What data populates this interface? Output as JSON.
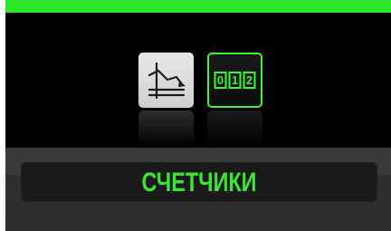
{
  "screen": {
    "accent_color": "#2de82a",
    "text_color": "#39e636"
  },
  "icons": [
    {
      "name": "graph-icon",
      "selected": false
    },
    {
      "name": "counter-icon",
      "selected": true,
      "digits": [
        "0",
        "1",
        "2"
      ]
    }
  ],
  "mode_label": "СЧЕТЧИКИ"
}
